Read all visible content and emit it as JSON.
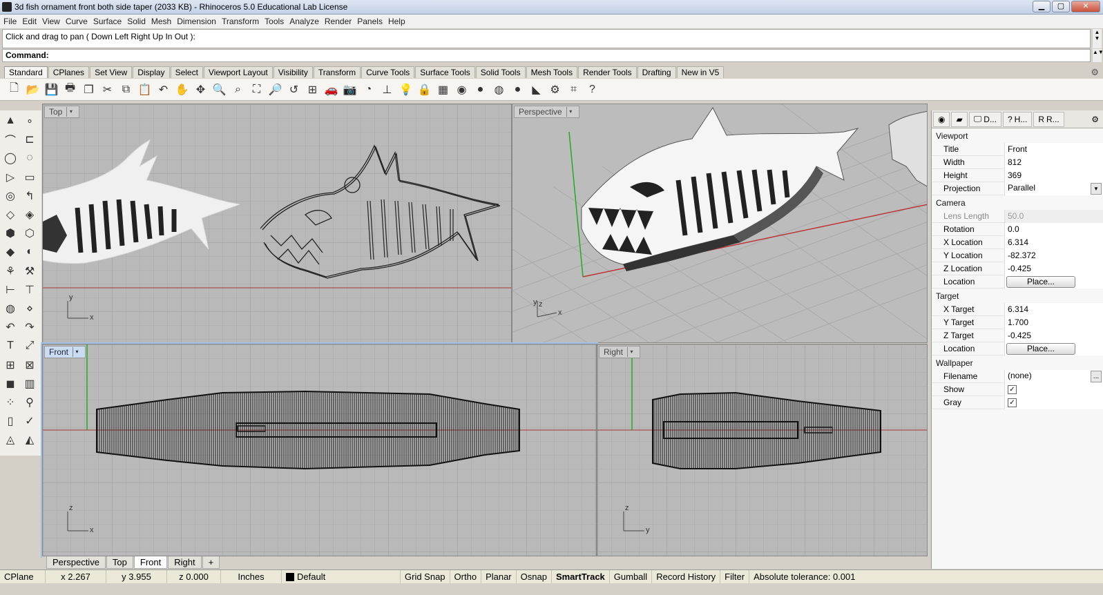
{
  "window": {
    "title": "3d fish ornament front both side taper (2033 KB) - Rhinoceros 5.0 Educational Lab License",
    "minimize": "▁",
    "maximize": "▢",
    "close": "✕"
  },
  "menu": [
    "File",
    "Edit",
    "View",
    "Curve",
    "Surface",
    "Solid",
    "Mesh",
    "Dimension",
    "Transform",
    "Tools",
    "Analyze",
    "Render",
    "Panels",
    "Help"
  ],
  "command": {
    "history": "Click and drag to pan ( Down  Left  Right  Up  In  Out ):",
    "prompt": "Command:"
  },
  "toolbar_tabs": [
    "Standard",
    "CPlanes",
    "Set View",
    "Display",
    "Select",
    "Viewport Layout",
    "Visibility",
    "Transform",
    "Curve Tools",
    "Surface Tools",
    "Solid Tools",
    "Mesh Tools",
    "Render Tools",
    "Drafting",
    "New in V5"
  ],
  "toolbar_icons": [
    "new-file-icon",
    "open-folder-icon",
    "save-icon",
    "print-icon",
    "copy-to-clipboard-icon",
    "cut-icon",
    "copy-icon",
    "paste-icon",
    "undo-icon",
    "pan-hand-icon",
    "rotate-view-icon",
    "zoom-dynamic-icon",
    "zoom-window-icon",
    "zoom-extents-icon",
    "zoom-selected-icon",
    "undo-view-icon",
    "four-viewports-icon",
    "car-named-view-icon",
    "camera-icon",
    "snapshot-icon",
    "cplane-icon",
    "light-bulb-icon",
    "lock-icon",
    "layer-icon",
    "color-wheel-icon",
    "shaded-sphere-icon",
    "rendered-sphere-icon",
    "blue-sphere-icon",
    "paint-bucket-icon",
    "options-gear-icon",
    "grid-icon",
    "help-icon"
  ],
  "toolbar_glyphs": [
    "🗋",
    "📂",
    "💾",
    "🖶",
    "❐",
    "✂",
    "⧉",
    "📋",
    "↶",
    "✋",
    "✥",
    "🔍",
    "⌕",
    "⛶",
    "🔎",
    "↺",
    "⊞",
    "🚗",
    "📷",
    "◔",
    "⊥",
    "💡",
    "🔒",
    "▦",
    "◉",
    "●",
    "◍",
    "●",
    "◣",
    "⚙",
    "⌗",
    "?"
  ],
  "left_tools": [
    "▲",
    "∘",
    "⌒",
    "⊏",
    "◯",
    "◌",
    "▷",
    "▭",
    "◎",
    "↰",
    "◇",
    "◈",
    "⬢",
    "⬡",
    "◆",
    "◐",
    "⚘",
    "⚒",
    "⊢",
    "⊤",
    "◍",
    "⋄",
    "↶",
    "↷",
    "T",
    "⤢",
    "⊞",
    "⊠",
    "◼",
    "▥",
    "⁘",
    "⚲",
    "▯",
    "✓",
    "◬",
    "◭"
  ],
  "viewports": {
    "top": {
      "label": "Top",
      "axis_v": "y",
      "axis_h": "x"
    },
    "perspective": {
      "label": "Perspective",
      "axis_v": "z",
      "axis_v2": "y",
      "axis_h": "x"
    },
    "front": {
      "label": "Front",
      "axis_v": "z",
      "axis_h": "x"
    },
    "right": {
      "label": "Right",
      "axis_v": "z",
      "axis_h": "y"
    },
    "dropdown": "▾"
  },
  "viewport_tabs": [
    "Perspective",
    "Top",
    "Front",
    "Right",
    "+"
  ],
  "panel": {
    "tabs": [
      {
        "icon": "color-wheel-icon",
        "glyph": "◉",
        "label": ""
      },
      {
        "icon": "layers-icon",
        "glyph": "▰",
        "label": ""
      },
      {
        "icon": "display-icon",
        "glyph": "🖵",
        "label": "D..."
      },
      {
        "icon": "help-icon",
        "glyph": "?",
        "label": "H..."
      },
      {
        "icon": "render-icon",
        "glyph": "R",
        "label": "R..."
      }
    ],
    "gear": "⚙",
    "viewport_section": "Viewport",
    "title_label": "Title",
    "title_value": "Front",
    "width_label": "Width",
    "width_value": "812",
    "height_label": "Height",
    "height_value": "369",
    "projection_label": "Projection",
    "projection_value": "Parallel",
    "camera_section": "Camera",
    "lens_label": "Lens Length",
    "lens_value": "50.0",
    "rotation_label": "Rotation",
    "rotation_value": "0.0",
    "xloc_label": "X Location",
    "xloc_value": "6.314",
    "yloc_label": "Y Location",
    "yloc_value": "-82.372",
    "zloc_label": "Z Location",
    "zloc_value": "-0.425",
    "loc_label": "Location",
    "place_button": "Place...",
    "target_section": "Target",
    "xt_label": "X Target",
    "xt_value": "6.314",
    "yt_label": "Y Target",
    "yt_value": "1.700",
    "zt_label": "Z Target",
    "zt_value": "-0.425",
    "tloc_label": "Location",
    "tplace_button": "Place...",
    "wallpaper_section": "Wallpaper",
    "filename_label": "Filename",
    "filename_value": "(none)",
    "browse_button": "...",
    "show_label": "Show",
    "show_checked": "✓",
    "gray_label": "Gray",
    "gray_checked": "✓"
  },
  "status": {
    "cplane": "CPlane",
    "x": "x 2.267",
    "y": "y 3.955",
    "z": "z 0.000",
    "units": "Inches",
    "layer": "Default",
    "layer_color": "#000000",
    "grid_snap": "Grid Snap",
    "ortho": "Ortho",
    "planar": "Planar",
    "osnap": "Osnap",
    "smarttrack": "SmartTrack",
    "gumball": "Gumball",
    "record_history": "Record History",
    "filter": "Filter",
    "tolerance": "Absolute tolerance: 0.001"
  }
}
